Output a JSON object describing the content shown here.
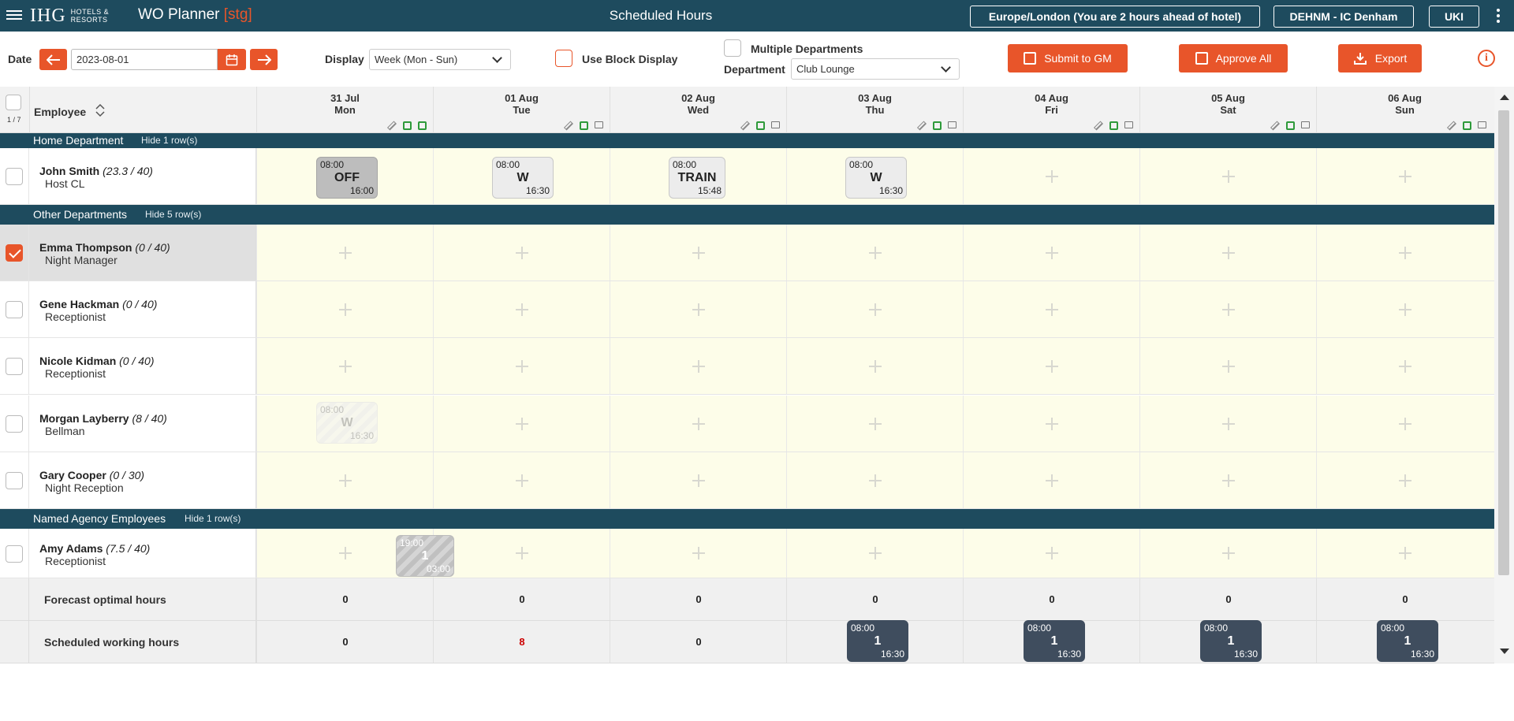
{
  "app": {
    "brand": "IHG",
    "brand_sub": "HOTELS & RESORTS",
    "title": "WO Planner",
    "env": "[stg]",
    "page_title": "Scheduled Hours"
  },
  "header_pills": {
    "timezone": "Europe/London (You are 2 hours ahead of hotel)",
    "hotel": "DEHNM - IC Denham",
    "region": "UKI"
  },
  "toolbar": {
    "date_label": "Date",
    "date_value": "2023-08-01",
    "display_label": "Display",
    "display_value": "Week (Mon - Sun)",
    "block_display_label": "Use Block Display",
    "multi_dept_label": "Multiple Departments",
    "department_label": "Department",
    "department_value": "Club Lounge",
    "submit_label": "Submit to GM",
    "approve_label": "Approve All",
    "export_label": "Export"
  },
  "grid": {
    "employee_header": "Employee",
    "selection_count": "1 / 7",
    "days": [
      {
        "date": "31 Jul",
        "dow": "Mon"
      },
      {
        "date": "01 Aug",
        "dow": "Tue"
      },
      {
        "date": "02 Aug",
        "dow": "Wed"
      },
      {
        "date": "03 Aug",
        "dow": "Thu"
      },
      {
        "date": "04 Aug",
        "dow": "Fri"
      },
      {
        "date": "05 Aug",
        "dow": "Sat"
      },
      {
        "date": "06 Aug",
        "dow": "Sun"
      }
    ],
    "sections": [
      {
        "name": "Home Department",
        "hide": "Hide 1 row(s)"
      },
      {
        "name": "Other Departments",
        "hide": "Hide 5 row(s)"
      },
      {
        "name": "Named Agency Employees",
        "hide": "Hide 1 row(s)"
      }
    ],
    "employees": [
      {
        "name": "John Smith",
        "hours": "(23.3 / 40)",
        "role": "Host CL",
        "selected": false
      },
      {
        "name": "Emma Thompson",
        "hours": "(0 / 40)",
        "role": "Night Manager",
        "selected": true
      },
      {
        "name": "Gene Hackman",
        "hours": "(0 / 40)",
        "role": "Receptionist",
        "selected": false
      },
      {
        "name": "Nicole Kidman",
        "hours": "(0 / 40)",
        "role": "Receptionist",
        "selected": false
      },
      {
        "name": "Morgan Layberry",
        "hours": "(8 / 40)",
        "role": "Bellman",
        "selected": false
      },
      {
        "name": "Gary Cooper",
        "hours": "(0 / 30)",
        "role": "Night Reception",
        "selected": false
      },
      {
        "name": "Amy Adams",
        "hours": "(7.5 / 40)",
        "role": "Receptionist",
        "selected": false
      }
    ],
    "shifts": {
      "john": [
        {
          "start": "08:00",
          "code": "OFF",
          "end": "16:00"
        },
        {
          "start": "08:00",
          "code": "W",
          "end": "16:30"
        },
        {
          "start": "08:00",
          "code": "TRAIN",
          "end": "15:48"
        },
        {
          "start": "08:00",
          "code": "W",
          "end": "16:30"
        }
      ],
      "morgan": {
        "start": "08:00",
        "code": "W",
        "end": "16:30"
      },
      "amy": {
        "start": "19:00",
        "code": "1",
        "end": "03:00"
      }
    },
    "forecast_label": "Forecast optimal hours",
    "forecast_values": [
      "0",
      "0",
      "0",
      "0",
      "0",
      "0",
      "0"
    ],
    "scheduled_label": "Scheduled working hours",
    "scheduled_values": [
      "0",
      "8",
      "0"
    ],
    "scheduled_shifts": [
      {
        "start": "08:00",
        "code": "1",
        "end": "16:30"
      },
      {
        "start": "08:00",
        "code": "1",
        "end": "16:30"
      },
      {
        "start": "08:00",
        "code": "1",
        "end": "16:30"
      },
      {
        "start": "08:00",
        "code": "1",
        "end": "16:30"
      }
    ]
  },
  "colors": {
    "header_bg": "#1e4b5e",
    "accent": "#e8552a",
    "cell_bg": "#fdfde9"
  }
}
